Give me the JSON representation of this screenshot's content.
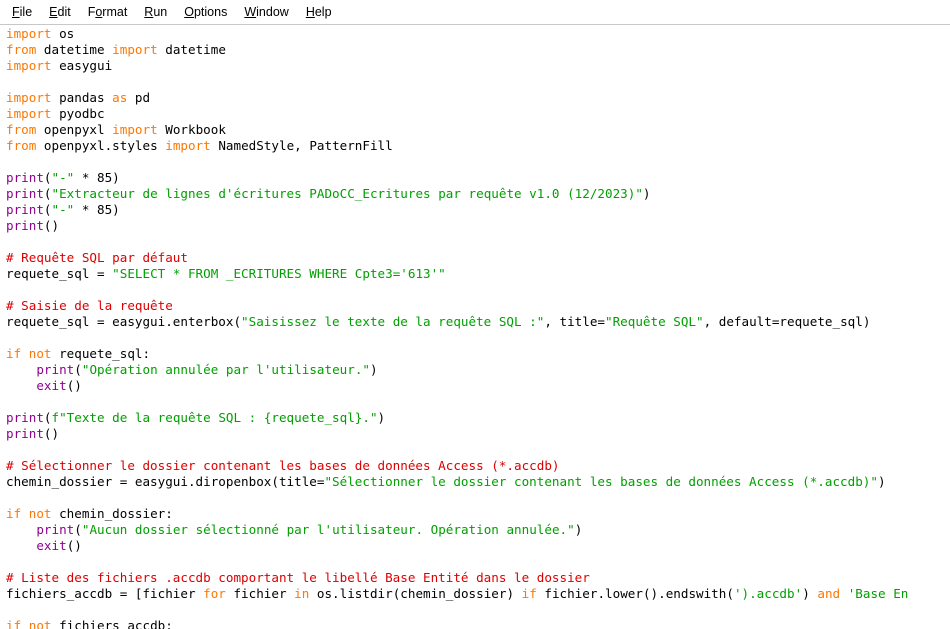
{
  "window": {
    "app": "IDLE Python Editor"
  },
  "menubar": {
    "items": [
      {
        "name": "file",
        "pre": "",
        "mn": "F",
        "post": "ile"
      },
      {
        "name": "edit",
        "pre": "",
        "mn": "E",
        "post": "dit"
      },
      {
        "name": "format",
        "pre": "F",
        "mn": "o",
        "post": "rmat"
      },
      {
        "name": "run",
        "pre": "",
        "mn": "R",
        "post": "un"
      },
      {
        "name": "options",
        "pre": "",
        "mn": "O",
        "post": "ptions"
      },
      {
        "name": "window",
        "pre": "",
        "mn": "W",
        "post": "indow"
      },
      {
        "name": "help",
        "pre": "",
        "mn": "H",
        "post": "elp"
      }
    ]
  },
  "colors": {
    "keyword": "#ff7700",
    "builtin": "#900090",
    "string": "#00a000",
    "comment": "#dd0000",
    "definition": "#0000ff",
    "text": "#000000",
    "background": "#ffffff",
    "menu_separator": "#c8c8c8"
  },
  "editor": {
    "language": "python",
    "lines": [
      [
        {
          "t": "import",
          "c": "kw"
        },
        {
          "t": " os",
          "c": "pln"
        }
      ],
      [
        {
          "t": "from",
          "c": "kw"
        },
        {
          "t": " datetime ",
          "c": "pln"
        },
        {
          "t": "import",
          "c": "kw"
        },
        {
          "t": " datetime",
          "c": "pln"
        }
      ],
      [
        {
          "t": "import",
          "c": "kw"
        },
        {
          "t": " easygui",
          "c": "pln"
        }
      ],
      [],
      [
        {
          "t": "import",
          "c": "kw"
        },
        {
          "t": " pandas ",
          "c": "pln"
        },
        {
          "t": "as",
          "c": "kw"
        },
        {
          "t": " pd",
          "c": "pln"
        }
      ],
      [
        {
          "t": "import",
          "c": "kw"
        },
        {
          "t": " pyodbc",
          "c": "pln"
        }
      ],
      [
        {
          "t": "from",
          "c": "kw"
        },
        {
          "t": " openpyxl ",
          "c": "pln"
        },
        {
          "t": "import",
          "c": "kw"
        },
        {
          "t": " Workbook",
          "c": "pln"
        }
      ],
      [
        {
          "t": "from",
          "c": "kw"
        },
        {
          "t": " openpyxl.styles ",
          "c": "pln"
        },
        {
          "t": "import",
          "c": "kw"
        },
        {
          "t": " NamedStyle, PatternFill",
          "c": "pln"
        }
      ],
      [],
      [
        {
          "t": "print",
          "c": "bi"
        },
        {
          "t": "(",
          "c": "pln"
        },
        {
          "t": "\"-\"",
          "c": "str"
        },
        {
          "t": " * 85)",
          "c": "pln"
        }
      ],
      [
        {
          "t": "print",
          "c": "bi"
        },
        {
          "t": "(",
          "c": "pln"
        },
        {
          "t": "\"Extracteur de lignes d'écritures PADoCC_Ecritures par requête v1.0 (12/2023)\"",
          "c": "str"
        },
        {
          "t": ")",
          "c": "pln"
        }
      ],
      [
        {
          "t": "print",
          "c": "bi"
        },
        {
          "t": "(",
          "c": "pln"
        },
        {
          "t": "\"-\"",
          "c": "str"
        },
        {
          "t": " * 85)",
          "c": "pln"
        }
      ],
      [
        {
          "t": "print",
          "c": "bi"
        },
        {
          "t": "()",
          "c": "pln"
        }
      ],
      [],
      [
        {
          "t": "# Requête SQL par défaut",
          "c": "cmt"
        }
      ],
      [
        {
          "t": "requete_sql = ",
          "c": "pln"
        },
        {
          "t": "\"SELECT * FROM _ECRITURES WHERE Cpte3='613'\"",
          "c": "str"
        }
      ],
      [],
      [
        {
          "t": "# Saisie de la requête",
          "c": "cmt"
        }
      ],
      [
        {
          "t": "requete_sql = easygui.enterbox(",
          "c": "pln"
        },
        {
          "t": "\"Saisissez le texte de la requête SQL :\"",
          "c": "str"
        },
        {
          "t": ", title=",
          "c": "pln"
        },
        {
          "t": "\"Requête SQL\"",
          "c": "str"
        },
        {
          "t": ", default=requete_sql)",
          "c": "pln"
        }
      ],
      [],
      [
        {
          "t": "if",
          "c": "kw"
        },
        {
          "t": " ",
          "c": "pln"
        },
        {
          "t": "not",
          "c": "kw"
        },
        {
          "t": " requete_sql:",
          "c": "pln"
        }
      ],
      [
        {
          "t": "    ",
          "c": "pln"
        },
        {
          "t": "print",
          "c": "bi"
        },
        {
          "t": "(",
          "c": "pln"
        },
        {
          "t": "\"Opération annulée par l'utilisateur.\"",
          "c": "str"
        },
        {
          "t": ")",
          "c": "pln"
        }
      ],
      [
        {
          "t": "    ",
          "c": "pln"
        },
        {
          "t": "exit",
          "c": "bi"
        },
        {
          "t": "()",
          "c": "pln"
        }
      ],
      [],
      [
        {
          "t": "print",
          "c": "bi"
        },
        {
          "t": "(",
          "c": "pln"
        },
        {
          "t": "f\"Texte de la requête SQL : {requete_sql}.\"",
          "c": "str"
        },
        {
          "t": ")",
          "c": "pln"
        }
      ],
      [
        {
          "t": "print",
          "c": "bi"
        },
        {
          "t": "()",
          "c": "pln"
        }
      ],
      [],
      [
        {
          "t": "# Sélectionner le dossier contenant les bases de données Access (*.accdb)",
          "c": "cmt"
        }
      ],
      [
        {
          "t": "chemin_dossier = easygui.diropenbox(title=",
          "c": "pln"
        },
        {
          "t": "\"Sélectionner le dossier contenant les bases de données Access (*.accdb)\"",
          "c": "str"
        },
        {
          "t": ")",
          "c": "pln"
        }
      ],
      [],
      [
        {
          "t": "if",
          "c": "kw"
        },
        {
          "t": " ",
          "c": "pln"
        },
        {
          "t": "not",
          "c": "kw"
        },
        {
          "t": " chemin_dossier:",
          "c": "pln"
        }
      ],
      [
        {
          "t": "    ",
          "c": "pln"
        },
        {
          "t": "print",
          "c": "bi"
        },
        {
          "t": "(",
          "c": "pln"
        },
        {
          "t": "\"Aucun dossier sélectionné par l'utilisateur. Opération annulée.\"",
          "c": "str"
        },
        {
          "t": ")",
          "c": "pln"
        }
      ],
      [
        {
          "t": "    ",
          "c": "pln"
        },
        {
          "t": "exit",
          "c": "bi"
        },
        {
          "t": "()",
          "c": "pln"
        }
      ],
      [],
      [
        {
          "t": "# Liste des fichiers .accdb comportant le libellé Base Entité dans le dossier",
          "c": "cmt"
        }
      ],
      [
        {
          "t": "fichiers_accdb = [fichier ",
          "c": "pln"
        },
        {
          "t": "for",
          "c": "kw"
        },
        {
          "t": " fichier ",
          "c": "pln"
        },
        {
          "t": "in",
          "c": "kw"
        },
        {
          "t": " os.listdir(chemin_dossier) ",
          "c": "pln"
        },
        {
          "t": "if",
          "c": "kw"
        },
        {
          "t": " fichier.lower().endswith(",
          "c": "pln"
        },
        {
          "t": "').accdb'",
          "c": "str"
        },
        {
          "t": ") ",
          "c": "pln"
        },
        {
          "t": "and",
          "c": "kw"
        },
        {
          "t": " ",
          "c": "pln"
        },
        {
          "t": "'Base En",
          "c": "str"
        }
      ],
      [],
      [
        {
          "t": "if",
          "c": "kw"
        },
        {
          "t": " ",
          "c": "pln"
        },
        {
          "t": "not",
          "c": "kw"
        },
        {
          "t": " fichiers_accdb:",
          "c": "pln"
        }
      ]
    ]
  }
}
